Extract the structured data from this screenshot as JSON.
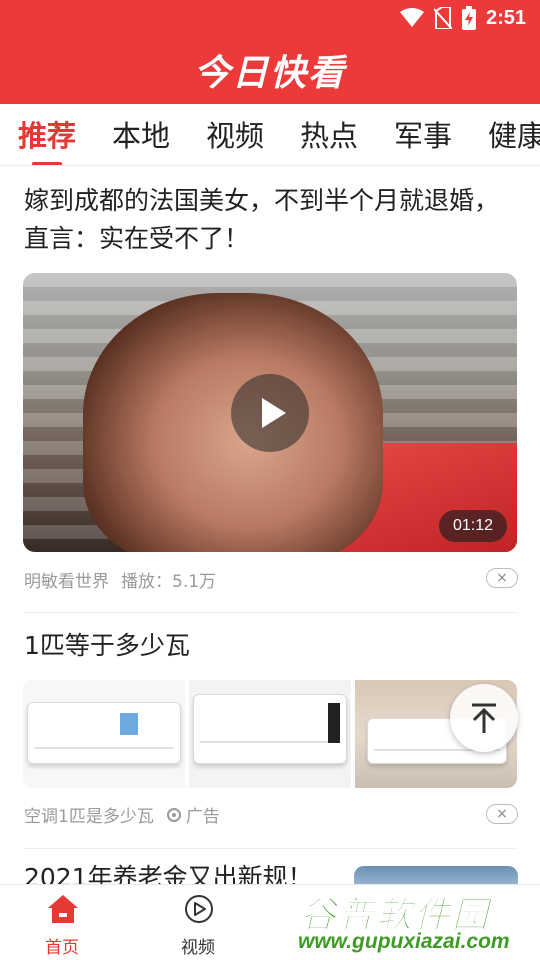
{
  "status_bar": {
    "time": "2:51",
    "icons": [
      "wifi-icon",
      "no-sim-icon",
      "battery-charging-icon"
    ]
  },
  "app": {
    "title": "今日快看"
  },
  "tabs": [
    {
      "label": "推荐",
      "active": true
    },
    {
      "label": "本地",
      "active": false
    },
    {
      "label": "视频",
      "active": false
    },
    {
      "label": "热点",
      "active": false
    },
    {
      "label": "军事",
      "active": false
    },
    {
      "label": "健康",
      "active": false
    }
  ],
  "feed": [
    {
      "title": "嫁到成都的法国美女，不到半个月就退婚，直言：实在受不了！",
      "video_duration": "01:12",
      "source": "明敏看世界",
      "plays": "播放：5.1万",
      "dismiss": "×"
    },
    {
      "title": "1匹等于多少瓦",
      "source": "空调1匹是多少瓦",
      "ad_label": "广告",
      "dismiss": "×"
    },
    {
      "title": "2021年养老金又出新规！"
    }
  ],
  "bottom_nav": [
    {
      "label": "首页",
      "icon": "home-icon",
      "active": true
    },
    {
      "label": "视频",
      "icon": "video-play-icon",
      "active": false
    }
  ],
  "watermark": {
    "text": "谷普软件园",
    "url": "www.gupuxiazai.com"
  },
  "colors": {
    "brand_red": "#ec3a3a",
    "active_red": "#e53935",
    "watermark_green": "#3e9b25"
  }
}
